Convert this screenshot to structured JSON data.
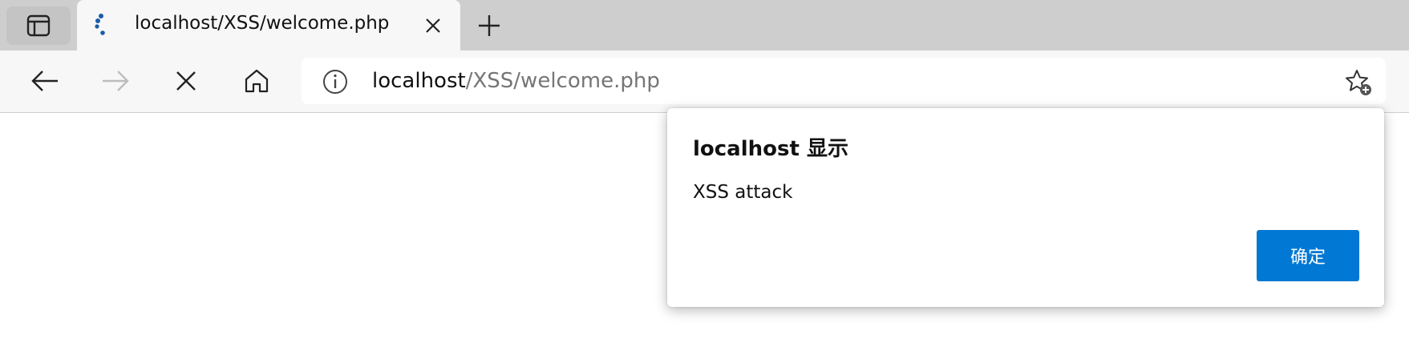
{
  "tab": {
    "title": "localhost/XSS/welcome.php",
    "favicon": "loading-spinner-icon"
  },
  "addressbar": {
    "host": "localhost",
    "path": "/XSS/welcome.php"
  },
  "dialog": {
    "title": "localhost 显示",
    "message": "XSS attack",
    "ok_label": "确定"
  },
  "colors": {
    "accent": "#0078d4",
    "tabbar_bg": "#cecece",
    "toolbar_bg": "#f7f7f7",
    "spinner": "#1a5ca8"
  }
}
